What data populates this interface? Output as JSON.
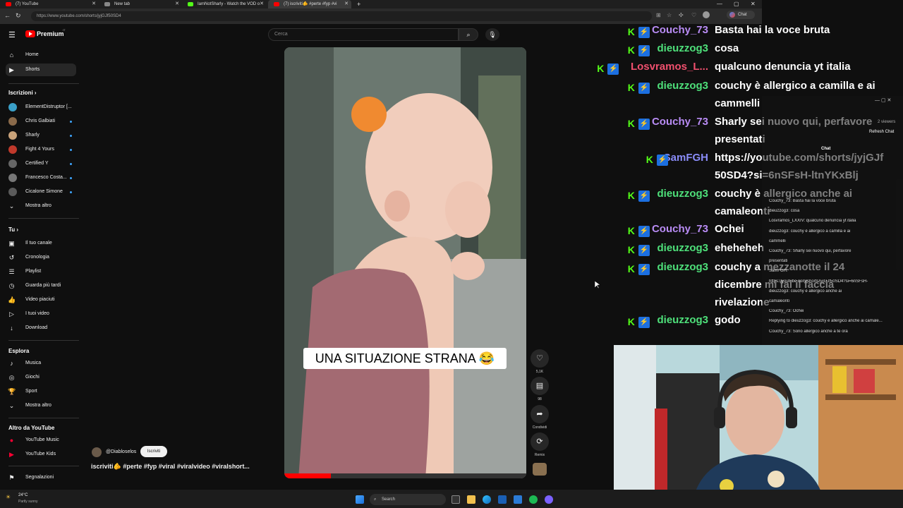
{
  "browser": {
    "tabs": [
      {
        "label": "(7) YouTube",
        "color": "#ff0000"
      },
      {
        "label": "New tab",
        "color": "#888888"
      },
      {
        "label": "IamNotSharly - Watch the VOD o",
        "color": "#53fc18"
      },
      {
        "label": "(7) iscriviti🫵 #perte #fyp #vi",
        "color": "#ff0000"
      }
    ],
    "url": "https://www.youtube.com/shorts/jyjGJf50SD4",
    "chat_label": "Chat",
    "new_tab_icon": "plus-icon"
  },
  "youtube": {
    "logo_text": "Premium",
    "logo_sup": "IT",
    "search_placeholder": "Cerca",
    "nav_main": [
      {
        "label": "Home",
        "icon": "⌂"
      },
      {
        "label": "Shorts",
        "icon": "▶"
      }
    ],
    "subscriptions_title": "Iscrizioni",
    "subscriptions": [
      {
        "label": "ElementDistruptor [...",
        "color": "#3aa0c8"
      },
      {
        "label": "Chris Galbiati",
        "color": "#8a6a4a"
      },
      {
        "label": "Sharly",
        "color": "#c9a27a"
      },
      {
        "label": "Fight 4 Yours",
        "color": "#c0392b"
      },
      {
        "label": "Certified Y",
        "color": "#666666"
      },
      {
        "label": "Francesco Costa...",
        "color": "#777777"
      },
      {
        "label": "Cicalone Simone",
        "color": "#5a5a5a"
      },
      {
        "label": "Mostra altro",
        "color": ""
      }
    ],
    "you_title": "Tu",
    "you_items": [
      {
        "label": "Il tuo canale",
        "icon": "▣"
      },
      {
        "label": "Cronologia",
        "icon": "↺"
      },
      {
        "label": "Playlist",
        "icon": "☰"
      },
      {
        "label": "Guarda più tardi",
        "icon": "◷"
      },
      {
        "label": "Video piaciuti",
        "icon": "👍"
      },
      {
        "label": "I tuoi video",
        "icon": "▷"
      },
      {
        "label": "Download",
        "icon": "↓"
      }
    ],
    "explore_title": "Esplora",
    "explore_items": [
      {
        "label": "Musica",
        "icon": "♪"
      },
      {
        "label": "Giochi",
        "icon": "◎"
      },
      {
        "label": "Sport",
        "icon": "🏆"
      },
      {
        "label": "Mostra altro",
        "icon": "⌄"
      }
    ],
    "more_title": "Altro da YouTube",
    "more_items": [
      {
        "label": "YouTube Music",
        "icon": "●"
      },
      {
        "label": "YouTube Kids",
        "icon": "▶"
      }
    ],
    "report_label": "Segnalazioni",
    "video": {
      "caption": "UNA SITUAZIONE STRANA 😂",
      "channel": "@Diabloselos",
      "subscribe_label": "Iscriviti",
      "title": "iscriviti🫵 #perte #fyp #viral #viralvideo #viralshort...",
      "likes": "5,1K",
      "comments": "98",
      "share_label": "Condividi",
      "remix_label": "Remix"
    }
  },
  "chat_overlay": [
    {
      "user": "Couchy_73",
      "color": "#b98cf5",
      "msg": "Basta hai la voce bruta",
      "msg2": ""
    },
    {
      "user": "dieuzzog3",
      "color": "#4ee07a",
      "msg": "cosa",
      "msg2": ""
    },
    {
      "user": "Losvramos_L...",
      "color": "#f0506e",
      "msg": "qualcuno denuncia yt italia",
      "msg2": ""
    },
    {
      "user": "dieuzzog3",
      "color": "#4ee07a",
      "msg": "couchy è allergico a camilla e ai",
      "msg2": "cammelli"
    },
    {
      "user": "Couchy_73",
      "color": "#b98cf5",
      "msg": "Sharly sei nuovo qui, perfavore",
      "msg2": "presentati"
    },
    {
      "user": "SamFGH",
      "color": "#8a8cf8",
      "msg": "https://youtube.com/shorts/jyjGJf",
      "msg2": "50SD4?si=6nSFsH-ltnYKxBlj"
    },
    {
      "user": "dieuzzog3",
      "color": "#4ee07a",
      "msg": "couchy è allergico anche ai",
      "msg2": "camaleonti"
    },
    {
      "user": "Couchy_73",
      "color": "#b98cf5",
      "msg": "Ochei",
      "msg2": ""
    },
    {
      "user": "dieuzzog3",
      "color": "#4ee07a",
      "msg": "eheheheh",
      "msg2": ""
    },
    {
      "user": "dieuzzog3",
      "color": "#4ee07a",
      "msg": "couchy a mezzanotte il 24",
      "msg2": "dicembre mi fai il faccia",
      "msg3": "rivelazione"
    },
    {
      "user": "dieuzzog3",
      "color": "#4ee07a",
      "msg": "godo",
      "msg2": ""
    }
  ],
  "mini_chat": {
    "viewers": "2 viewers",
    "refresh": "Refresh Chat",
    "title": "Chat",
    "lines": [
      "Couchy_73: Basta hai la voce bruta",
      "dieuzzog3: cosa",
      "Losvramos_LXXIV: qualcuno denuncia yt italia",
      "dieuzzog3: couchy è allergico a camilla e ai",
      "cammelli",
      "Couchy_73: Sharly sei nuovo qui, perfavore",
      "presentati",
      "SamFGH:",
      "https://youtube.com/shorts/jyjGJf50SD4?si=6nSFsH-",
      "dieuzzog3: couchy è allergico anche ai",
      "camaleonti",
      "Couchy_73: Ochei",
      "Replying to dieuzzog3: couchy è allergico anche ai camale...",
      "Couchy_73: Sono allergico anche a te ora"
    ]
  },
  "taskbar": {
    "weather_temp": "24°C",
    "weather_desc": "Partly sunny",
    "search_label": "Search"
  }
}
